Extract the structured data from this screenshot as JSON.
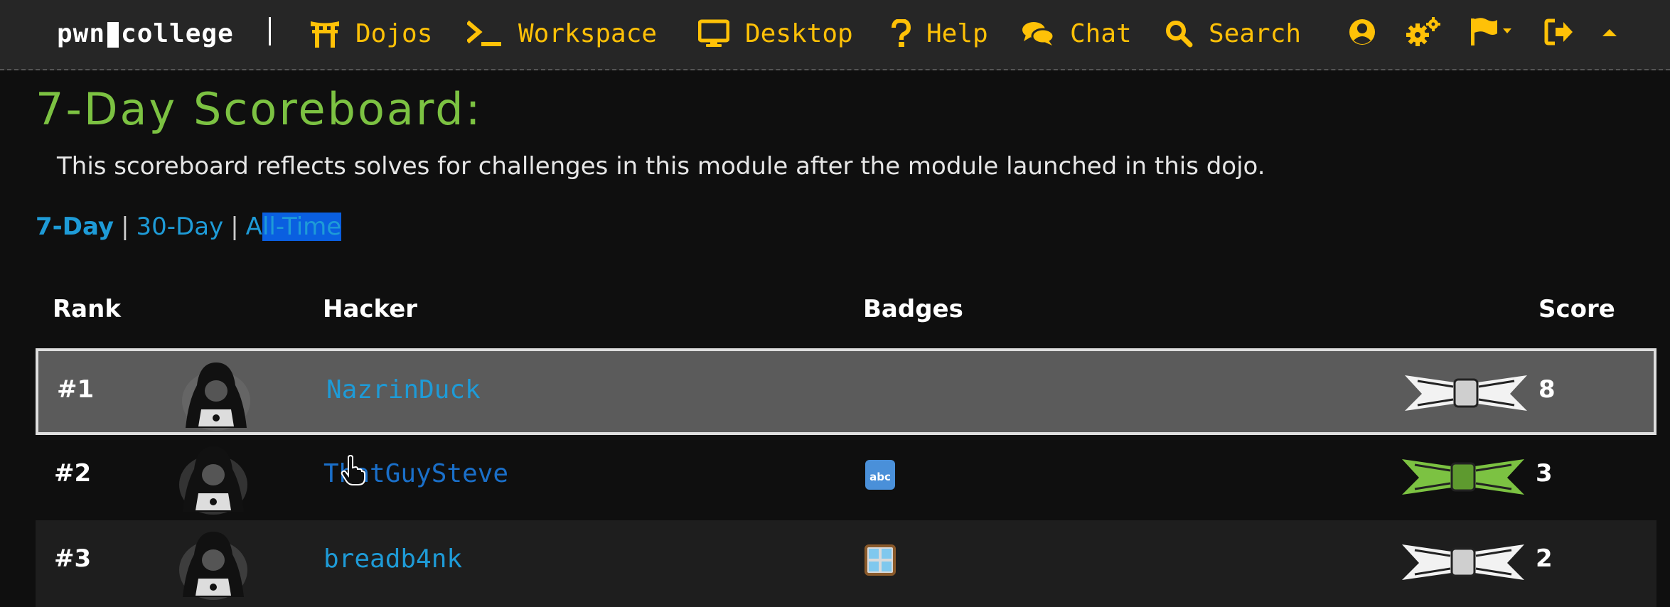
{
  "navbar": {
    "brand_left": "pwn",
    "brand_right": "college",
    "items": [
      {
        "label": "Dojos",
        "icon": "torii-gate-icon"
      },
      {
        "label": "Workspace",
        "icon": "terminal-icon"
      },
      {
        "label": "Desktop",
        "icon": "desktop-icon"
      },
      {
        "label": "Help",
        "icon": "question-icon"
      },
      {
        "label": "Chat",
        "icon": "comments-icon"
      },
      {
        "label": "Search",
        "icon": "search-icon"
      }
    ],
    "icon_buttons": [
      "user-circle-icon",
      "cogs-icon",
      "flag-dropdown-icon",
      "sign-out-icon",
      "caret-up-icon"
    ],
    "accent_color": "#ffc107"
  },
  "page": {
    "title": "7-Day Scoreboard:",
    "subtitle": "This scoreboard reflects solves for challenges in this module after the module launched in this dojo.",
    "ranges": {
      "seven": "7-Day",
      "thirty": "30-Day",
      "all_prefix": "A",
      "all_selected": "ll-Time"
    },
    "title_color": "#7cc242",
    "link_color": "#1e9bd7"
  },
  "table": {
    "headers": {
      "rank": "Rank",
      "hacker": "Hacker",
      "badges": "Badges",
      "score": "Score"
    },
    "rows": [
      {
        "rank": "#1",
        "hacker": "NazrinDuck",
        "badge": "",
        "belt": "white",
        "score": "8"
      },
      {
        "rank": "#2",
        "hacker": "ThatGuySteve",
        "badge": "abc",
        "belt": "green",
        "score": "3"
      },
      {
        "rank": "#3",
        "hacker": "breadb4nk",
        "badge": "window",
        "belt": "white",
        "score": "2"
      }
    ]
  }
}
